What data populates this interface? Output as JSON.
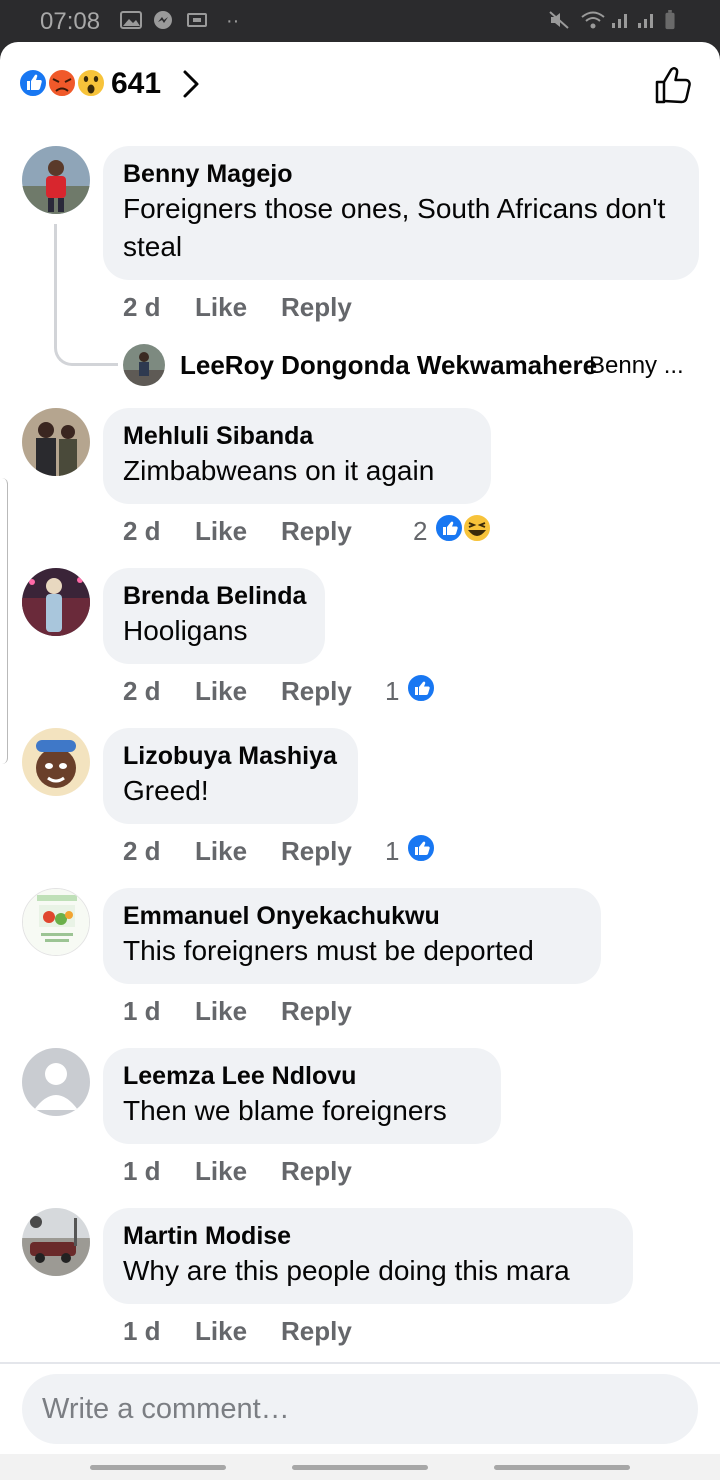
{
  "status_bar": {
    "time": "07:08"
  },
  "header": {
    "reaction_count": "641"
  },
  "comments": [
    {
      "name": "Benny Magejo",
      "text": "Foreigners those ones, South Africans don't steal",
      "age": "2 d",
      "like_label": "Like",
      "reply_label": "Reply",
      "reply_preview": {
        "name": "LeeRoy Dongonda Wekwamahere",
        "text": "Benny ..."
      }
    },
    {
      "name": "Mehluli Sibanda",
      "text": "Zimbabweans on it again",
      "age": "2 d",
      "like_label": "Like",
      "reply_label": "Reply",
      "reaction_count": "2"
    },
    {
      "name": "Brenda Belinda",
      "text": "Hooligans",
      "age": "2 d",
      "like_label": "Like",
      "reply_label": "Reply",
      "reaction_count": "1"
    },
    {
      "name": "Lizobuya Mashiya",
      "text": "Greed!",
      "age": "2 d",
      "like_label": "Like",
      "reply_label": "Reply",
      "reaction_count": "1"
    },
    {
      "name": "Emmanuel Onyekachukwu",
      "text": "This foreigners must be deported",
      "age": "1 d",
      "like_label": "Like",
      "reply_label": "Reply"
    },
    {
      "name": "Leemza Lee Ndlovu",
      "text": "Then we blame foreigners",
      "age": "1 d",
      "like_label": "Like",
      "reply_label": "Reply"
    },
    {
      "name": "Martin Modise",
      "text": "Why are this people doing this mara",
      "age": "1 d",
      "like_label": "Like",
      "reply_label": "Reply"
    }
  ],
  "composer": {
    "placeholder": "Write a comment…"
  },
  "colors": {
    "like_blue": "#1877f2",
    "bubble_bg": "#f0f2f5",
    "meta_gray": "#65676b"
  }
}
